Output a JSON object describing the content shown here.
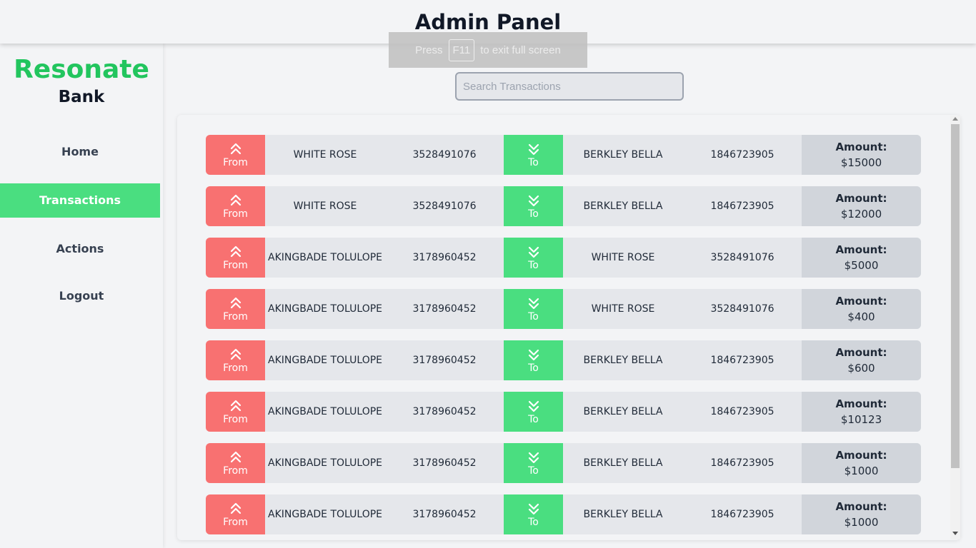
{
  "header": {
    "title": "Admin Panel"
  },
  "fullscreen_notice": {
    "prefix": "Press",
    "key": "F11",
    "suffix": "to exit full screen"
  },
  "brand": {
    "name": "Resonate",
    "sub": "Bank"
  },
  "nav": [
    {
      "label": "Home",
      "active": false
    },
    {
      "label": "Transactions",
      "active": true
    },
    {
      "label": "Actions",
      "active": false
    },
    {
      "label": "Logout",
      "active": false
    }
  ],
  "search": {
    "placeholder": "Search Transactions",
    "value": ""
  },
  "labels": {
    "from": "From",
    "to": "To",
    "amount": "Amount:"
  },
  "colors": {
    "brand": "#22c55e",
    "from": "#f87171",
    "to": "#4ade80",
    "active_nav": "#4ade80"
  },
  "icons": {
    "from": "chevrons-up-icon",
    "to": "chevrons-down-icon"
  },
  "transactions": [
    {
      "from_name": "WHITE ROSE",
      "from_account": "3528491076",
      "to_name": "BERKLEY BELLA",
      "to_account": "1846723905",
      "amount": "$15000"
    },
    {
      "from_name": "WHITE ROSE",
      "from_account": "3528491076",
      "to_name": "BERKLEY BELLA",
      "to_account": "1846723905",
      "amount": "$12000"
    },
    {
      "from_name": "AKINGBADE TOLULOPE",
      "from_account": "3178960452",
      "to_name": "WHITE ROSE",
      "to_account": "3528491076",
      "amount": "$5000"
    },
    {
      "from_name": "AKINGBADE TOLULOPE",
      "from_account": "3178960452",
      "to_name": "WHITE ROSE",
      "to_account": "3528491076",
      "amount": "$400"
    },
    {
      "from_name": "AKINGBADE TOLULOPE",
      "from_account": "3178960452",
      "to_name": "BERKLEY BELLA",
      "to_account": "1846723905",
      "amount": "$600"
    },
    {
      "from_name": "AKINGBADE TOLULOPE",
      "from_account": "3178960452",
      "to_name": "BERKLEY BELLA",
      "to_account": "1846723905",
      "amount": "$10123"
    },
    {
      "from_name": "AKINGBADE TOLULOPE",
      "from_account": "3178960452",
      "to_name": "BERKLEY BELLA",
      "to_account": "1846723905",
      "amount": "$1000"
    },
    {
      "from_name": "AKINGBADE TOLULOPE",
      "from_account": "3178960452",
      "to_name": "BERKLEY BELLA",
      "to_account": "1846723905",
      "amount": "$1000"
    }
  ]
}
